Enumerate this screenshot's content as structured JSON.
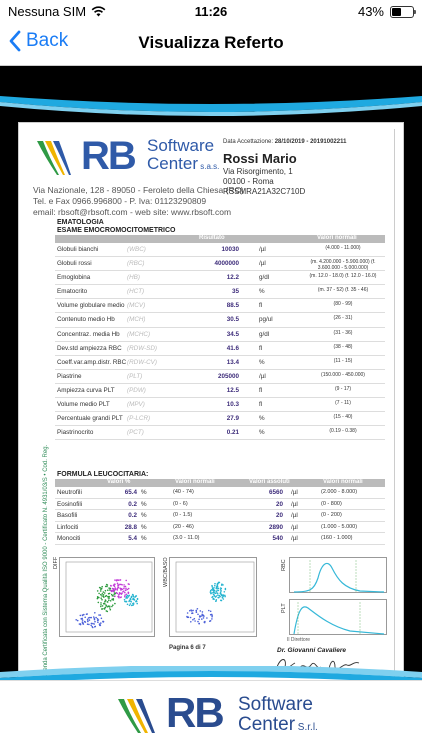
{
  "status_bar": {
    "carrier": "Nessuna SIM",
    "time": "11:26",
    "battery": "43%",
    "battery_level": 0.43
  },
  "nav": {
    "back_label": "Back",
    "title": "Visualizza Referto"
  },
  "report": {
    "logo_rb": "RB",
    "logo_software": "Software",
    "logo_center": "Center",
    "logo_sas": " s.a.s.",
    "company_address": "Via Nazionale, 128 - 89050 - Feroleto della Chiesa (RC)",
    "company_phone": "Tel. e Fax 0966.996800 - P. Iva: 01123290809",
    "company_web": "email: rbsoft@rbsoft.com - web site: www.rbsoft.com",
    "acceptance_label": "Data Accettazione:",
    "acceptance_value": "28/10/2019 - 20191002211",
    "patient_name": "Rossi Mario",
    "patient_street": "Via Risorgimento, 1",
    "patient_city": "00100 - Roma",
    "patient_cf": "RSSMRA21A32C710D",
    "section_ematologia": "EMATOLOGIA",
    "section_esame": "ESAME EMOCROMOCITOMETRICO",
    "header_risultato": "Risultato",
    "header_valori_normali": "Valori normali",
    "rows": [
      {
        "name": "Globuli bianchi",
        "code": "(WBC)",
        "result": "10030",
        "unit": "/µl",
        "normal": "(4.000 - 11.000)"
      },
      {
        "name": "Globuli rossi",
        "code": "(RBC)",
        "result": "4000000",
        "unit": "/µl",
        "normal": "(m. 4.200.000 - 5.900.000) (f. 3.600.000 - 5.000.000)"
      },
      {
        "name": "Emoglobina",
        "code": "(HB)",
        "result": "12.2",
        "unit": "g/dl",
        "normal": "(m. 12.0 - 18.0) (f. 12.0 - 16.0)"
      },
      {
        "name": "Ematocrito",
        "code": "(HCT)",
        "result": "35",
        "unit": "%",
        "normal": "(m. 37 - 52) (f. 35 - 46)"
      },
      {
        "name": "Volume globulare medio",
        "code": "(MCV)",
        "result": "88.5",
        "unit": "fl",
        "normal": "(80 - 99)"
      },
      {
        "name": "Contenuto medio Hb",
        "code": "(MCH)",
        "result": "30.5",
        "unit": "pg/ul",
        "normal": "(26 - 31)"
      },
      {
        "name": "Concentraz. media Hb",
        "code": "(MCHC)",
        "result": "34.5",
        "unit": "g/dl",
        "normal": "(31 - 36)"
      },
      {
        "name": "Dev.std ampiezza RBC",
        "code": "(RDW-SD)",
        "result": "41.6",
        "unit": "fl",
        "normal": "(38 - 48)"
      },
      {
        "name": "Coeff.var.amp.distr. RBC",
        "code": "(RDW-CV)",
        "result": "13.4",
        "unit": "%",
        "normal": "(11 - 15)"
      },
      {
        "name": "Piastrine",
        "code": "(PLT)",
        "result": "205000",
        "unit": "/µl",
        "normal": "(150.000 - 450.000)"
      },
      {
        "name": "Ampiezza curva PLT",
        "code": "(PDW)",
        "result": "12.5",
        "unit": "fl",
        "normal": "(9 - 17)"
      },
      {
        "name": "Volume medio PLT",
        "code": "(MPV)",
        "result": "10.3",
        "unit": "fl",
        "normal": "(7 - 11)"
      },
      {
        "name": "Percentuale grandi PLT",
        "code": "(P-LCR)",
        "result": "27.9",
        "unit": "%",
        "normal": "(15 - 40)"
      },
      {
        "name": "Piastrinocrito",
        "code": "(PCT)",
        "result": "0.21",
        "unit": "%",
        "normal": "(0.19 - 0.38)"
      }
    ],
    "section_formula": "FORMULA LEUCOCITARIA:",
    "leuko_headers": {
      "pct": "Valori %",
      "normal1": "Valori normali",
      "abs": "Valori assoluti",
      "normal2": "Valori normali"
    },
    "leuko_rows": [
      {
        "name": "Neutrofili",
        "pct": "65.4",
        "pct_unit": "%",
        "normal1": "(40 - 74)",
        "abs": "6560",
        "abs_unit": "/µl",
        "normal2": "(2.000 - 8.000)"
      },
      {
        "name": "Eosinofili",
        "pct": "0.2",
        "pct_unit": "%",
        "normal1": "(0 - 6)",
        "abs": "20",
        "abs_unit": "/µl",
        "normal2": "(0 - 800)"
      },
      {
        "name": "Basofili",
        "pct": "0.2",
        "pct_unit": "%",
        "normal1": "(0 - 1.5)",
        "abs": "20",
        "abs_unit": "/µl",
        "normal2": "(0 - 200)"
      },
      {
        "name": "Linfociti",
        "pct": "28.8",
        "pct_unit": "%",
        "normal1": "(20 - 46)",
        "abs": "2890",
        "abs_unit": "/µl",
        "normal2": "(1.000 - 5.000)"
      },
      {
        "name": "Monociti",
        "pct": "5.4",
        "pct_unit": "%",
        "normal1": "(3.0 - 11.0)",
        "abs": "540",
        "abs_unit": "/µl",
        "normal2": "(160 - 1.000)"
      }
    ],
    "side_text": "Azienda Certificata con Sistema Qualità ISO 9000 - Certificato N. 4931/03/S • Cod. Reg.",
    "plot_diff": "DIFF",
    "plot_wbc": "WBC/BASO",
    "plot_rbc": "RBC",
    "plot_plt": "PLT",
    "page_number": "Pagina 6 di 7",
    "director_label": "Il Direttore",
    "doctor_name": "Dr. Giovanni Cavaliere"
  },
  "footer": {
    "rb": "RB",
    "software": "Software",
    "center": "Center",
    "srl": " S.r.l."
  },
  "colors": {
    "ios_blue": "#1a7cf5",
    "brand_blue": "#2f5aa8",
    "wave_cyan": "#1fa9e0",
    "result_purple": "#3d2c7a"
  }
}
